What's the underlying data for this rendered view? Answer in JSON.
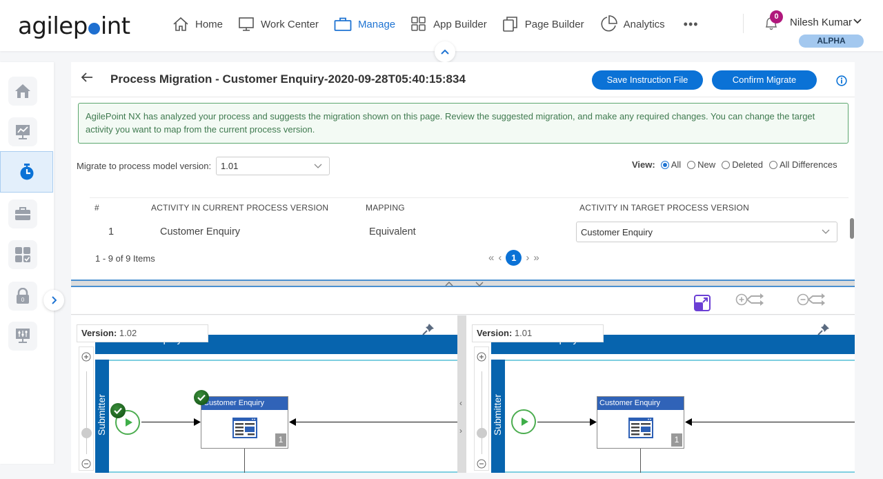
{
  "brand": {
    "logo_pre": "agilep",
    "logo_post": "int"
  },
  "nav": {
    "items": [
      {
        "label": "Home",
        "icon": "home-icon"
      },
      {
        "label": "Work Center",
        "icon": "monitor-icon"
      },
      {
        "label": "Manage",
        "icon": "briefcase-icon",
        "active": true
      },
      {
        "label": "App Builder",
        "icon": "grid-icon"
      },
      {
        "label": "Page Builder",
        "icon": "pages-icon"
      },
      {
        "label": "Analytics",
        "icon": "pie-chart-icon"
      }
    ],
    "more_label": "•••"
  },
  "user": {
    "notifications": "0",
    "name": "Nilesh Kumar",
    "environment": "ALPHA"
  },
  "sidebar": {
    "items": [
      {
        "name": "home",
        "icon": "home-icon"
      },
      {
        "name": "dashboard",
        "icon": "chart-monitor-icon"
      },
      {
        "name": "timer",
        "icon": "stopwatch-icon",
        "active": true
      },
      {
        "name": "tools",
        "icon": "toolbox-icon"
      },
      {
        "name": "apps",
        "icon": "apps-check-icon"
      },
      {
        "name": "security",
        "icon": "lock-icon"
      },
      {
        "name": "settings",
        "icon": "sliders-monitor-icon"
      }
    ]
  },
  "header": {
    "title": "Process Migration - Customer Enquiry-2020-09-28T05:40:15:834",
    "save_label": "Save Instruction File",
    "confirm_label": "Confirm Migrate"
  },
  "notice": "AgilePoint NX has analyzed your process and suggests the migration shown on this page. Review the suggested migration, and make any required changes. You can change the target activity you want to map from the current process version.",
  "migrate": {
    "label": "Migrate to process model version:",
    "value": "1.01"
  },
  "view": {
    "label": "View:",
    "options": [
      {
        "label": "All",
        "checked": true
      },
      {
        "label": "New",
        "checked": false
      },
      {
        "label": "Deleted",
        "checked": false
      },
      {
        "label": "All Differences",
        "checked": false
      }
    ]
  },
  "table": {
    "columns": [
      "#",
      "ACTIVITY IN CURRENT PROCESS VERSION",
      "MAPPING",
      "ACTIVITY IN TARGET PROCESS VERSION"
    ],
    "rows": [
      {
        "num": "1",
        "current": "Customer Enquiry",
        "mapping": "Equivalent",
        "target": "Customer Enquiry"
      }
    ],
    "items_count": "1 - 9 of 9 Items",
    "current_page": "1"
  },
  "diagram_left": {
    "version_label": "Version:",
    "version": "1.02",
    "pool": "Customer Enquiry",
    "lane": "Submitter",
    "activity": "Customer Enquiry",
    "activity_num": "1"
  },
  "diagram_right": {
    "version_label": "Version:",
    "version": "1.01",
    "pool": "Customer Enquiry",
    "lane": "Submitter",
    "activity": "Customer Enquiry",
    "activity_num": "1"
  }
}
